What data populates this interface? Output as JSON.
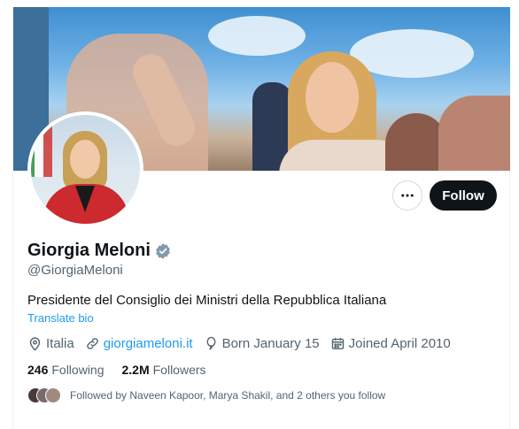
{
  "profile": {
    "display_name": "Giorgia Meloni",
    "handle": "@GiorgiaMeloni",
    "bio": "Presidente del Consiglio dei Ministri della Repubblica Italiana",
    "translate_label": "Translate bio",
    "location": "Italia",
    "website": "giorgiameloni.it",
    "born": "Born January 15",
    "joined": "Joined April 2010",
    "following_count": "246",
    "following_label": "Following",
    "followers_count": "2.2M",
    "followers_label": "Followers",
    "followed_by": "Followed by Naveen Kapoor, Marya Shakil, and 2 others you follow"
  },
  "actions": {
    "follow_label": "Follow",
    "more_icon": "more-horizontal-icon"
  },
  "colors": {
    "accent": "#1d9bf0",
    "text_primary": "#0f1419",
    "text_secondary": "#536471",
    "follow_button_bg": "#0f1419",
    "verified_badge": "#829aab"
  },
  "icons": [
    "verified-badge-icon",
    "location-icon",
    "link-icon",
    "balloon-icon",
    "calendar-icon",
    "more-horizontal-icon"
  ]
}
